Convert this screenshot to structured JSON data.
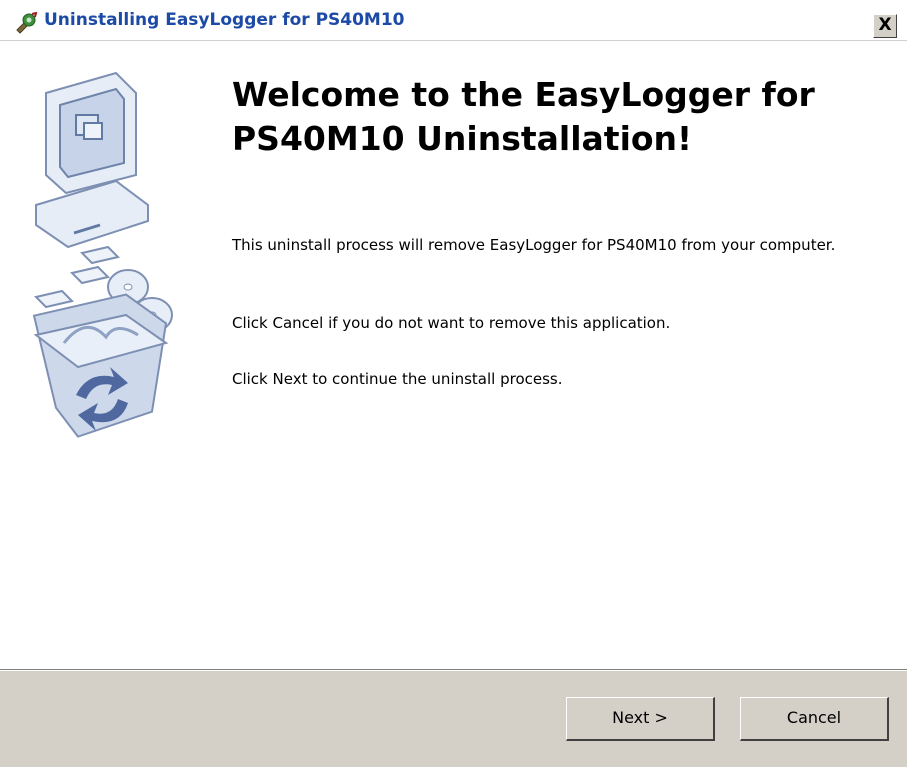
{
  "window": {
    "title": "Uninstalling EasyLogger for PS40M10",
    "close_label": "X"
  },
  "main": {
    "heading": "Welcome to the EasyLogger for PS40M10 Uninstallation!",
    "paragraphs": [
      "This uninstall process will remove EasyLogger for PS40M10 from your computer.",
      "Click Cancel if you do not want to remove this application.",
      "Click Next to continue the uninstall process."
    ],
    "illustration_icons": [
      "computer-icon",
      "disks-icon",
      "recycle-bin-icon"
    ]
  },
  "footer": {
    "next_label": "Next >",
    "cancel_label": "Cancel"
  },
  "colors": {
    "title_text": "#1c4aa6",
    "dialog_face": "#d4d0c8",
    "content_bg": "#ffffff"
  }
}
